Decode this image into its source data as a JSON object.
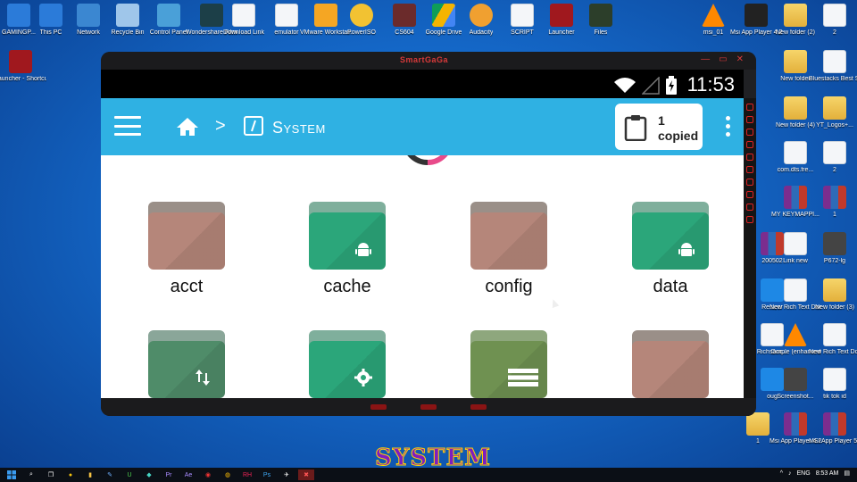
{
  "desktop": {
    "top_icons": [
      {
        "label": "GAMINGP...",
        "icon": "computer-icon"
      },
      {
        "label": "This PC",
        "icon": "computer-icon"
      },
      {
        "label": "Network",
        "icon": "network-icon"
      },
      {
        "label": "Recycle Bin",
        "icon": "recycle-bin-icon"
      },
      {
        "label": "Control Panel",
        "icon": "control-panel-icon"
      },
      {
        "label": "Wondershare Filmora 12",
        "icon": "filmora-icon"
      },
      {
        "label": "Download Link",
        "icon": "document-icon"
      },
      {
        "label": "emulator",
        "icon": "document-icon"
      },
      {
        "label": "VMware Workstati...",
        "icon": "vmware-icon"
      },
      {
        "label": "PowerISO",
        "icon": "poweriso-icon"
      },
      {
        "label": "CS604",
        "icon": "book-icon"
      },
      {
        "label": "Google Drive",
        "icon": "google-drive-icon"
      },
      {
        "label": "Audacity",
        "icon": "audacity-icon"
      },
      {
        "label": "SCRIPT",
        "icon": "document-icon"
      },
      {
        "label": "Launcher",
        "icon": "launcher-icon"
      },
      {
        "label": "Files",
        "icon": "files-icon"
      }
    ],
    "left_icons": [
      {
        "label": "Launcher - Shortcut",
        "icon": "launcher-icon"
      }
    ],
    "right_icons": [
      {
        "label": "msi_01",
        "icon": "vlc-icon"
      },
      {
        "label": "Msi App Player 4.2...",
        "icon": "msi-icon"
      },
      {
        "label": "New folder (2)",
        "icon": "folder-icon"
      },
      {
        "label": "2",
        "icon": "document-icon"
      },
      {
        "label": "New folder",
        "icon": "folder-icon"
      },
      {
        "label": "Bluestacks Best Setting",
        "icon": "document-icon"
      },
      {
        "label": "New folder (4)",
        "icon": "folder-icon"
      },
      {
        "label": "YT_Logos+...",
        "icon": "folder-icon"
      },
      {
        "label": "com.dts.fre...",
        "icon": "document-icon"
      },
      {
        "label": "2",
        "icon": "document-icon"
      },
      {
        "label": "MY KEYMAPPI...",
        "icon": "winrar-icon"
      },
      {
        "label": "1",
        "icon": "winrar-icon"
      },
      {
        "label": "200502",
        "icon": "winrar-icon"
      },
      {
        "label": "Link new",
        "icon": "document-icon"
      },
      {
        "label": "P672-lg",
        "icon": "image-icon"
      },
      {
        "label": "Resizer",
        "icon": "app-icon"
      },
      {
        "label": "New Rich Text Doc...",
        "icon": "document-icon"
      },
      {
        "label": "New folder (3)",
        "icon": "folder-icon"
      },
      {
        "label": "Rich Doc...",
        "icon": "document-icon"
      },
      {
        "label": "sample (enhanced)",
        "icon": "vlc-icon"
      },
      {
        "label": "New Rich Text Doc...",
        "icon": "document-icon"
      },
      {
        "label": "oug",
        "icon": "app-icon"
      },
      {
        "label": "Screenshot...",
        "icon": "image-icon"
      },
      {
        "label": "tik tok id",
        "icon": "document-icon"
      },
      {
        "label": "1",
        "icon": "folder-icon"
      },
      {
        "label": "Msi App Player 4.2...",
        "icon": "winrar-icon"
      },
      {
        "label": "MSI App Player 5.12...",
        "icon": "winrar-icon"
      }
    ]
  },
  "emulator": {
    "brand": "SmartGaGa",
    "status": {
      "time": "11:53"
    },
    "appbar": {
      "menu_icon": "hamburger-icon",
      "home_icon": "home-icon",
      "separator": ">",
      "folder_title": "System",
      "copied_count": "1",
      "copied_label": "copied"
    },
    "folders": [
      {
        "name": "acct",
        "color": "#b5867a",
        "tab": "#9a8f88",
        "glyph": ""
      },
      {
        "name": "cache",
        "color": "#2ba67a",
        "tab": "#7faf9c",
        "glyph": "android-icon"
      },
      {
        "name": "config",
        "color": "#b5867a",
        "tab": "#9a8f88",
        "glyph": ""
      },
      {
        "name": "data",
        "color": "#2ba67a",
        "tab": "#7faf9c",
        "glyph": "android-icon"
      },
      {
        "name": "",
        "color": "#4f8c69",
        "tab": "#8aa699",
        "glyph": "transfer-icon"
      },
      {
        "name": "",
        "color": "#2ba67a",
        "tab": "#7faf9c",
        "glyph": "gear-icon"
      },
      {
        "name": "",
        "color": "#6f9151",
        "tab": "#8ea77d",
        "glyph": "list-icon"
      },
      {
        "name": "",
        "color": "#b5867a",
        "tab": "#9a8f88",
        "glyph": ""
      }
    ]
  },
  "caption": "SYSTEM",
  "taskbar": {
    "time": "8:53 AM",
    "lang": "ENG"
  },
  "colors": {
    "appbar": "#2fb1e3",
    "accent_red": "#d73a3a"
  }
}
